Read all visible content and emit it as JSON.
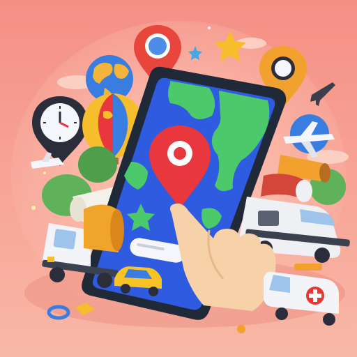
{
  "scene": {
    "description_free": true
  },
  "colors": {
    "background_top": "#f58f86",
    "background_bottom": "#f9b4a3",
    "phone_body": "#1f2937",
    "screen_ocean": "#2f5be0",
    "land_green": "#4cc96b",
    "pin_red": "#e8373d",
    "pin_orange": "#f2a12e",
    "star_yellow": "#f6bd2c",
    "globe_blue": "#3a7de0",
    "truck_white": "#f2f4f8",
    "truck_orange": "#f0a52a",
    "taxi_yellow": "#f7c325",
    "hand_skin": "#f7d2a9",
    "bush_green": "#5fb25a",
    "airplane_white": "#f4f6fb",
    "ambulance_red": "#e53935"
  },
  "icons": [
    "map-pin-icon",
    "star-icon",
    "globe-icon",
    "clock-pin-icon",
    "hot-air-balloon-icon",
    "airplane-icon",
    "jet-icon",
    "fuel-truck-icon",
    "camper-van-icon",
    "ambulance-icon",
    "taxi-icon",
    "pointing-hand-icon",
    "smartphone-icon",
    "search-bar-icon"
  ]
}
